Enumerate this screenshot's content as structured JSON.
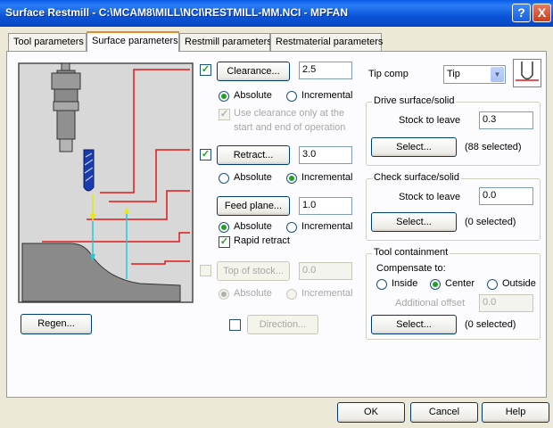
{
  "window": {
    "title": "Surface Restmill - C:\\MCAM8\\MILL\\NCI\\RESTMILL-MM.NCI - MPFAN",
    "help": "?",
    "close": "X"
  },
  "tabs": [
    {
      "label": "Tool parameters"
    },
    {
      "label": "Surface parameters"
    },
    {
      "label": "Restmill parameters"
    },
    {
      "label": "Restmaterial parameters"
    }
  ],
  "active_tab": "Surface parameters",
  "clearance": {
    "checked": true,
    "button": "Clearance...",
    "value": "2.5",
    "absolute": "Absolute",
    "incremental": "Incremental",
    "mode": "Absolute",
    "note_line1": "Use clearance only at the",
    "note_line2": "start and end of operation",
    "note_checked": true
  },
  "retract": {
    "checked": true,
    "button": "Retract...",
    "value": "3.0",
    "absolute": "Absolute",
    "incremental": "Incremental",
    "mode": "Incremental"
  },
  "feed_plane": {
    "button": "Feed plane...",
    "value": "1.0",
    "absolute": "Absolute",
    "incremental": "Incremental",
    "mode": "Absolute",
    "rapid_retract": "Rapid retract",
    "rapid_checked": true
  },
  "top_of_stock": {
    "checked": false,
    "button": "Top of stock...",
    "value": "0.0",
    "absolute": "Absolute",
    "incremental": "Incremental",
    "mode": "Absolute"
  },
  "direction": {
    "checked": false,
    "button": "Direction..."
  },
  "regen": {
    "button": "Regen..."
  },
  "tip_comp": {
    "label": "Tip comp",
    "value": "Tip"
  },
  "drive": {
    "title": "Drive surface/solid",
    "stock_label": "Stock to leave",
    "stock_value": "0.3",
    "select": "Select...",
    "selected": "(88  selected)"
  },
  "check": {
    "title": "Check surface/solid",
    "stock_label": "Stock to leave",
    "stock_value": "0.0",
    "select": "Select...",
    "selected": "(0  selected)"
  },
  "containment": {
    "title": "Tool containment",
    "compensate_label": "Compensate to:",
    "inside": "Inside",
    "center": "Center",
    "outside": "Outside",
    "mode": "Center",
    "additional_label": "Additional offset",
    "additional_value": "0.0",
    "select": "Select...",
    "selected": "(0  selected)"
  },
  "footer": {
    "ok": "OK",
    "cancel": "Cancel",
    "help": "Help"
  },
  "colors": {
    "title_blue": "#0b55d8",
    "diagram_bg": "#d8d8d8",
    "red_lines": "#e01818",
    "arrow_yellow": "#e8e800",
    "arrow_cyan": "#20c8d8"
  }
}
